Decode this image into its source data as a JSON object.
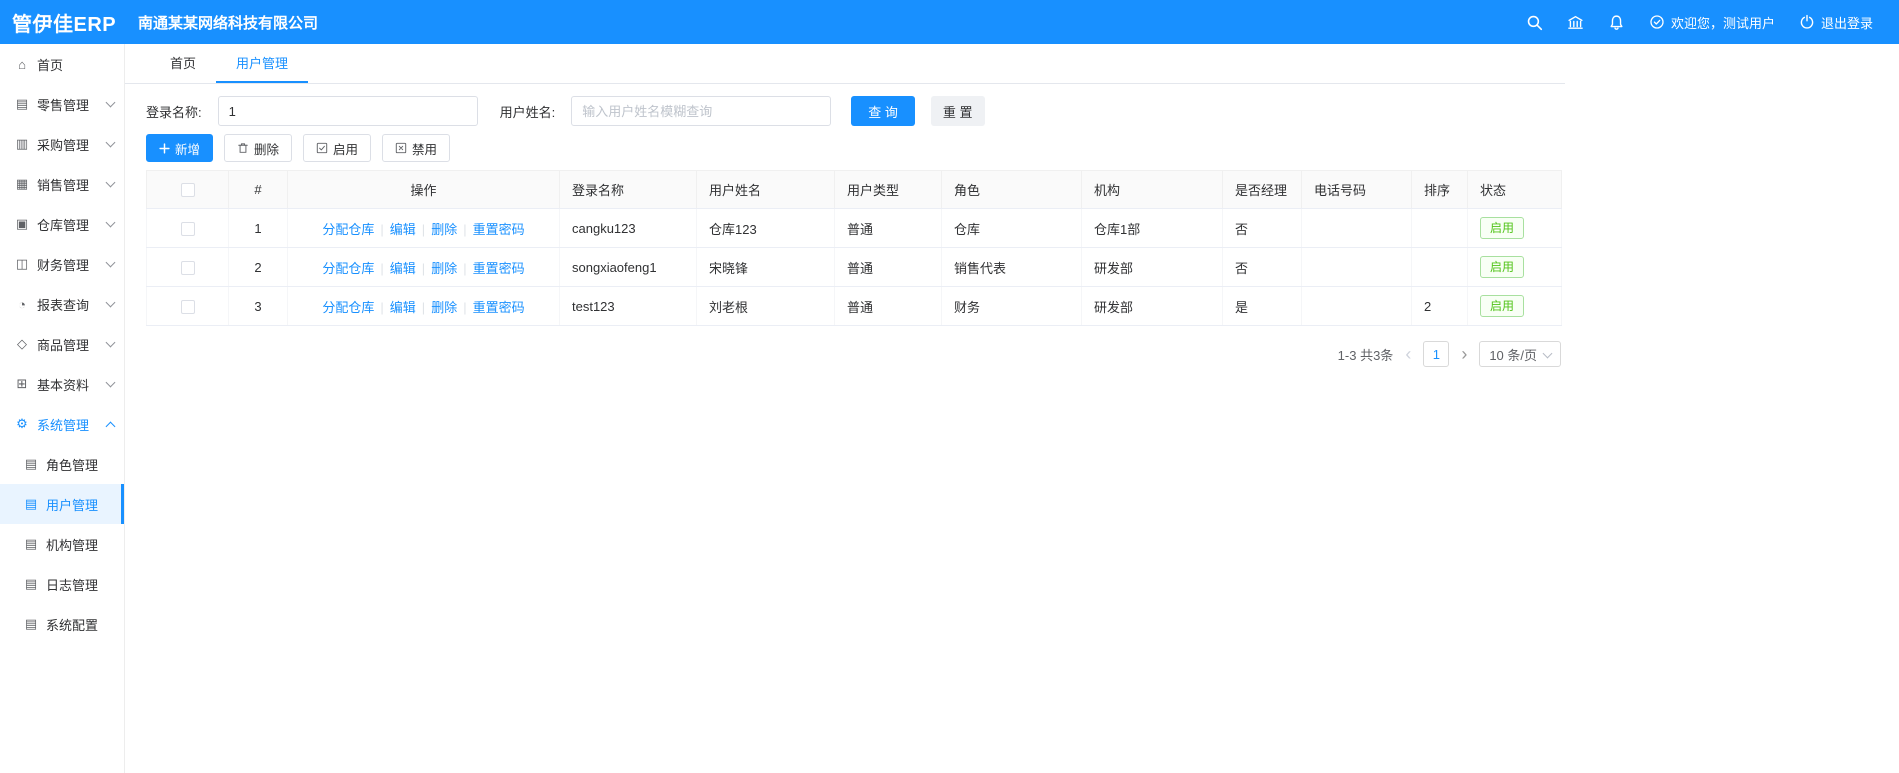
{
  "colors": {
    "accent": "#1890ff",
    "status_green": "#52c41a"
  },
  "header": {
    "logo": "管伊佳ERP",
    "company": "南通某某网络科技有限公司",
    "welcome": "欢迎您，测试用户",
    "logout": "退出登录"
  },
  "sidebar": {
    "items": [
      {
        "name": "home",
        "label": "首页",
        "icon": "home-icon",
        "chevron": null
      },
      {
        "name": "retail",
        "label": "零售管理",
        "icon": "retail-icon",
        "chevron": "down"
      },
      {
        "name": "purchase",
        "label": "采购管理",
        "icon": "purchase-icon",
        "chevron": "down"
      },
      {
        "name": "sales",
        "label": "销售管理",
        "icon": "sales-icon",
        "chevron": "down"
      },
      {
        "name": "warehouse",
        "label": "仓库管理",
        "icon": "warehouse-icon",
        "chevron": "down"
      },
      {
        "name": "finance",
        "label": "财务管理",
        "icon": "finance-icon",
        "chevron": "down"
      },
      {
        "name": "report",
        "label": "报表查询",
        "icon": "report-icon",
        "chevron": "down"
      },
      {
        "name": "goods",
        "label": "商品管理",
        "icon": "goods-icon",
        "chevron": "down"
      },
      {
        "name": "basic",
        "label": "基本资料",
        "icon": "basic-icon",
        "chevron": "down"
      },
      {
        "name": "system",
        "label": "系统管理",
        "icon": "system-icon",
        "chevron": "up",
        "active": true,
        "expanded": true
      }
    ],
    "subitems": [
      {
        "name": "role",
        "label": "角色管理",
        "active": false
      },
      {
        "name": "user",
        "label": "用户管理",
        "active": true
      },
      {
        "name": "org",
        "label": "机构管理",
        "active": false
      },
      {
        "name": "log",
        "label": "日志管理",
        "active": false
      },
      {
        "name": "config",
        "label": "系统配置",
        "active": false
      }
    ]
  },
  "tabs": [
    {
      "name": "home",
      "label": "首页",
      "active": false
    },
    {
      "name": "user-management",
      "label": "用户管理",
      "active": true
    }
  ],
  "filter": {
    "login_label": "登录名称:",
    "login_value": "1",
    "name_label": "用户姓名:",
    "name_placeholder": "输入用户姓名模糊查询",
    "search_label": "查 询",
    "reset_label": "重 置"
  },
  "toolbar": {
    "add_label": "新增",
    "delete_label": "删除",
    "enable_label": "启用",
    "disable_label": "禁用"
  },
  "table": {
    "columns": [
      "#",
      "操作",
      "登录名称",
      "用户姓名",
      "用户类型",
      "角色",
      "机构",
      "是否经理",
      "电话号码",
      "排序",
      "状态"
    ],
    "action_links": [
      "分配仓库",
      "编辑",
      "删除",
      "重置密码"
    ],
    "rows": [
      {
        "index": "1",
        "login": "cangku123",
        "name": "仓库123",
        "type": "普通",
        "role": "仓库",
        "org": "仓库1部",
        "manager": "否",
        "phone": "",
        "sort": "",
        "status": "启用"
      },
      {
        "index": "2",
        "login": "songxiaofeng1",
        "name": "宋晓锋",
        "type": "普通",
        "role": "销售代表",
        "org": "研发部",
        "manager": "否",
        "phone": "",
        "sort": "",
        "status": "启用"
      },
      {
        "index": "3",
        "login": "test123",
        "name": "刘老根",
        "type": "普通",
        "role": "财务",
        "org": "研发部",
        "manager": "是",
        "phone": "",
        "sort": "2",
        "status": "启用"
      }
    ]
  },
  "pagination": {
    "summary": "1-3 共3条",
    "page": "1",
    "page_size": "10 条/页"
  }
}
